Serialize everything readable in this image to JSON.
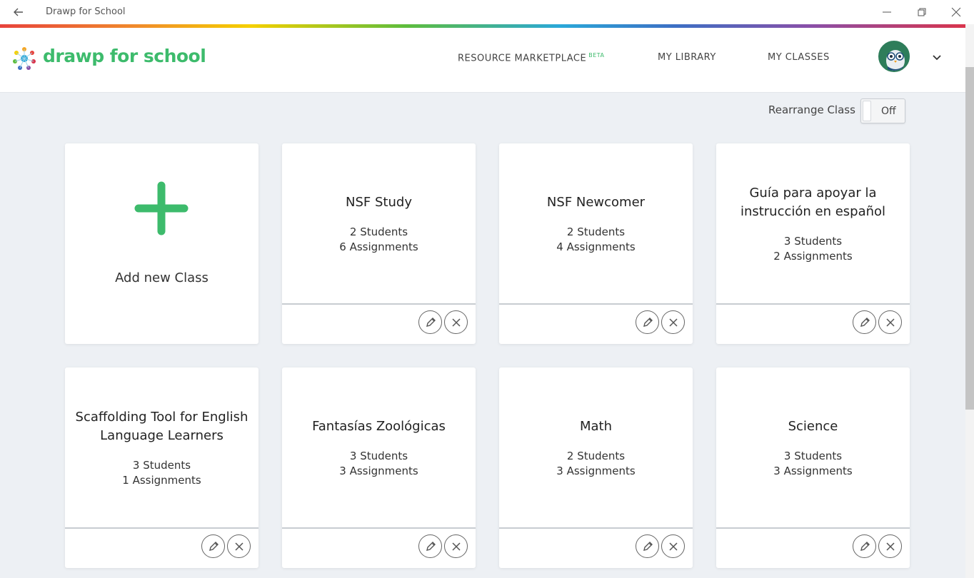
{
  "window": {
    "title": "Drawp for School"
  },
  "header": {
    "brand": "drawp for school",
    "nav": [
      {
        "label": "RESOURCE MARKETPLACE",
        "badge": "BETA"
      },
      {
        "label": "MY LIBRARY"
      },
      {
        "label": "MY CLASSES"
      }
    ]
  },
  "toolbar": {
    "rearrange_label": "Rearrange Class",
    "toggle_state": "Off"
  },
  "add_card": {
    "label": "Add new Class"
  },
  "classes": [
    {
      "name": "NSF Study",
      "students": "2 Students",
      "assignments": "6 Assignments"
    },
    {
      "name": "NSF Newcomer",
      "students": "2 Students",
      "assignments": "4 Assignments"
    },
    {
      "name": "Guía para apoyar la instrucción en español",
      "students": "3 Students",
      "assignments": "2 Assignments"
    },
    {
      "name": "Scaffolding Tool for English Language Learners",
      "students": "3 Students",
      "assignments": "1 Assignments"
    },
    {
      "name": "Fantasías Zoológicas",
      "students": "3 Students",
      "assignments": "3 Assignments"
    },
    {
      "name": "Math",
      "students": "2 Students",
      "assignments": "3 Assignments"
    },
    {
      "name": "Science",
      "students": "3 Students",
      "assignments": "3 Assignments"
    }
  ],
  "colors": {
    "brand_green": "#3dbb6c",
    "background": "#edf0f4"
  },
  "icons": {
    "back": "arrow-left-icon",
    "edit": "pencil-icon",
    "delete": "close-icon",
    "add": "plus-icon"
  }
}
